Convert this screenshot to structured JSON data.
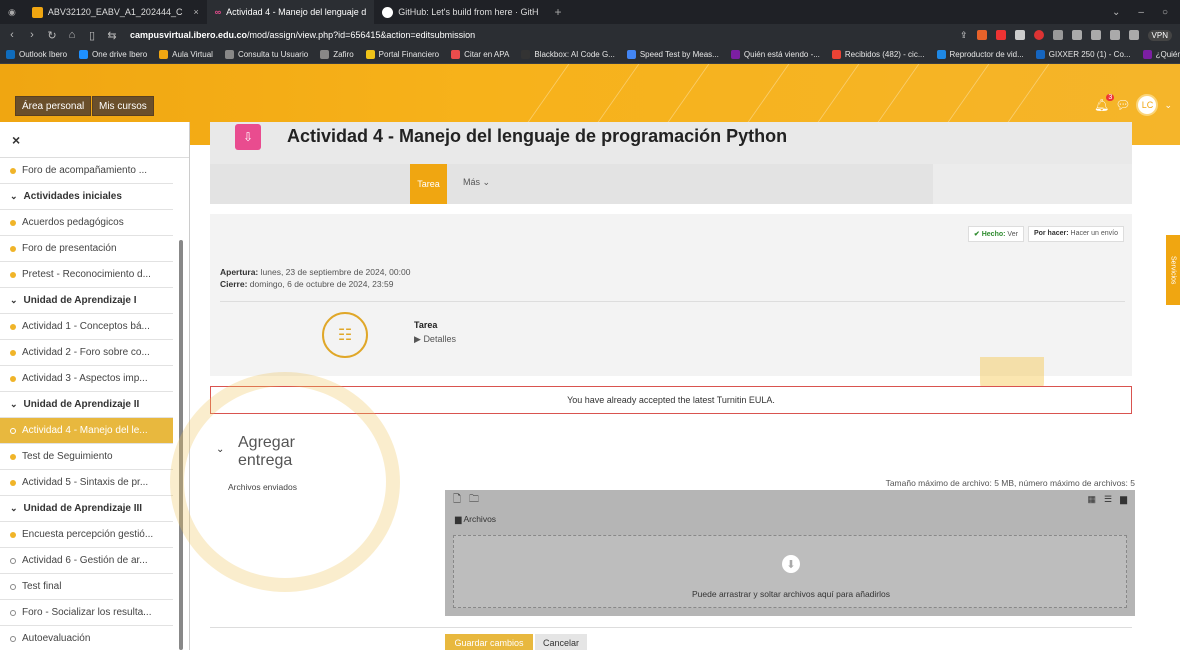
{
  "browser": {
    "tabs": [
      {
        "label": "ABV32120_EABV_A1_202444_C",
        "color": "#f0a611"
      },
      {
        "label": "Actividad 4 - Manejo del lenguaje d",
        "color": "#e94c8f"
      },
      {
        "label": "GitHub: Let's build from here · GitH",
        "color": "#ffffff"
      }
    ],
    "url_host": "campusvirtual.ibero.edu.co",
    "url_path": "/mod/assign/view.php?id=656415&action=editsubmission",
    "vpn_label": "VPN"
  },
  "bookmarks": [
    {
      "label": "Outlook Ibero",
      "color": "#0f6cbd"
    },
    {
      "label": "One drive Ibero",
      "color": "#1e90ff"
    },
    {
      "label": "Aula Virtual",
      "color": "#f0a611"
    },
    {
      "label": "Consulta tu Usuario",
      "color": "#888888"
    },
    {
      "label": "Zafiro",
      "color": "#888888"
    },
    {
      "label": "Portal Financiero",
      "color": "#f0c419"
    },
    {
      "label": "Citar en APA",
      "color": "#e94c4c"
    },
    {
      "label": "Blackbox: AI Code G...",
      "color": "#333333"
    },
    {
      "label": "Speed Test by Meas...",
      "color": "#4285f4"
    },
    {
      "label": "Quién está viendo -...",
      "color": "#7b1fa2"
    },
    {
      "label": "Recibidos (482) - cic...",
      "color": "#ea4335"
    },
    {
      "label": "Reproductor de vid...",
      "color": "#1e88e5"
    },
    {
      "label": "GIXXER 250 (1) - Co...",
      "color": "#1565c0"
    },
    {
      "label": "¿Quién está viendo?...",
      "color": "#7b1fa2"
    }
  ],
  "header": {
    "nav": [
      "Área personal",
      "Mis cursos"
    ],
    "notif_count": "3",
    "avatar_initials": "LC"
  },
  "sidebar": {
    "close_label": "×",
    "items": [
      {
        "label": "Foro de acompañamiento ...",
        "type": "item",
        "done": true
      },
      {
        "label": "Actividades iniciales",
        "type": "section"
      },
      {
        "label": "Acuerdos pedagógicos",
        "type": "item",
        "done": true
      },
      {
        "label": "Foro de presentación",
        "type": "item",
        "done": true
      },
      {
        "label": "Pretest - Reconocimiento d...",
        "type": "item",
        "done": true
      },
      {
        "label": "Unidad de Aprendizaje I",
        "type": "section"
      },
      {
        "label": "Actividad 1 - Conceptos bá...",
        "type": "item",
        "done": true
      },
      {
        "label": "Actividad 2 - Foro sobre co...",
        "type": "item",
        "done": true
      },
      {
        "label": "Actividad 3 - Aspectos imp...",
        "type": "item",
        "done": true
      },
      {
        "label": "Unidad de Aprendizaje II",
        "type": "section"
      },
      {
        "label": "Actividad 4 - Manejo del le...",
        "type": "active",
        "done": false
      },
      {
        "label": "Test de Seguimiento",
        "type": "item",
        "done": true
      },
      {
        "label": "Actividad 5 - Sintaxis de pr...",
        "type": "item",
        "done": true
      },
      {
        "label": "Unidad de Aprendizaje III",
        "type": "section"
      },
      {
        "label": "Encuesta percepción gestió...",
        "type": "item",
        "done": true
      },
      {
        "label": "Actividad 6 - Gestión de ar...",
        "type": "item",
        "done": false
      },
      {
        "label": "Test final",
        "type": "item",
        "done": false
      },
      {
        "label": "Foro - Socializar los resulta...",
        "type": "item",
        "done": false
      },
      {
        "label": "Autoevaluación",
        "type": "item",
        "done": false
      }
    ]
  },
  "page": {
    "title": "Actividad 4 - Manejo del lenguaje de programación Python",
    "tab_active": "Tarea",
    "tab_more": "Más",
    "status_done_label": "Hecho:",
    "status_done_value": "Ver",
    "status_todo_label": "Por hacer:",
    "status_todo_value": "Hacer un envío",
    "opening_label": "Apertura:",
    "opening_value": "lunes, 23 de septiembre de 2024, 00:00",
    "closing_label": "Cierre:",
    "closing_value": "domingo, 6 de octubre de 2024, 23:59",
    "tarea_label": "Tarea",
    "details_label": "Detalles",
    "eula_text": "You have already accepted the latest Turnitin EULA.",
    "section_title": "Agregar entrega",
    "files_label": "Archivos enviados",
    "size_info": "Tamaño máximo de archivo: 5 MB, número máximo de archivos: 5",
    "folder_label": "Archivos",
    "drop_text": "Puede arrastrar y soltar archivos aquí para añadirlos",
    "save_label": "Guardar cambios",
    "cancel_label": "Cancelar",
    "side_tab": "Servicios"
  }
}
